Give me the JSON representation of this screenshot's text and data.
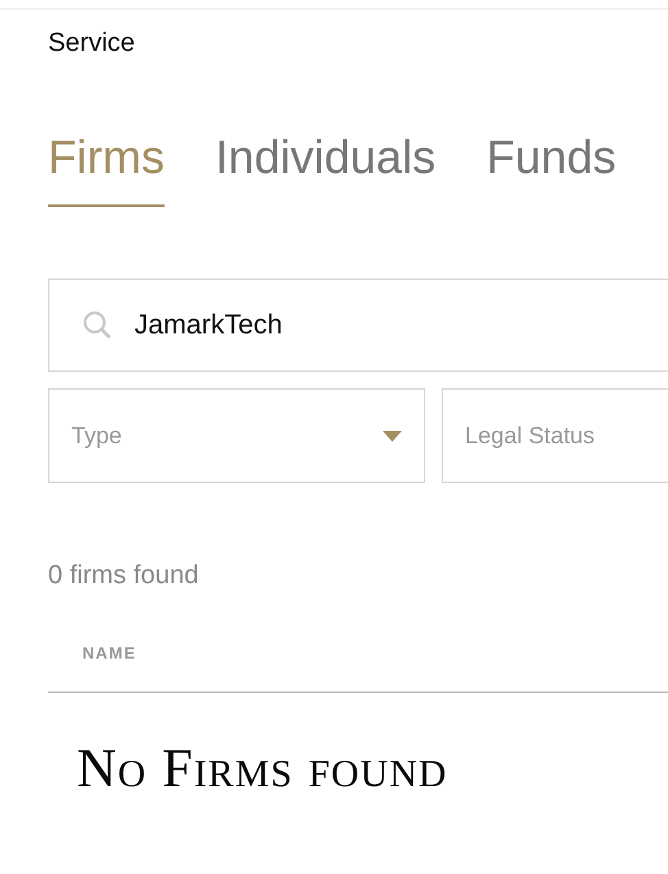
{
  "breadcrumb": "Service",
  "tabs": [
    {
      "label": "Firms",
      "selected": true
    },
    {
      "label": "Individuals",
      "selected": false
    },
    {
      "label": "Funds",
      "selected": false
    }
  ],
  "search": {
    "value": "JamarkTech"
  },
  "filters": [
    {
      "placeholder": "Type",
      "dropdown": true
    },
    {
      "placeholder": "Legal Status",
      "dropdown": false
    }
  ],
  "result_count": "0 firms found",
  "table": {
    "columns": [
      "NAME"
    ],
    "empty_message": "No Firms found"
  }
}
